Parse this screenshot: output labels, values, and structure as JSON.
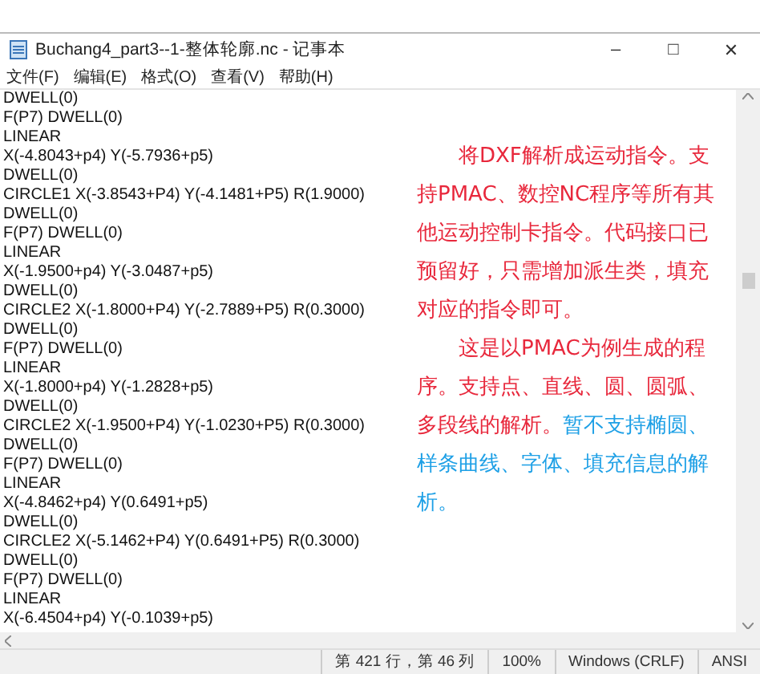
{
  "window": {
    "title": "Buchang4_part3--1-整体轮廓.nc - 记事本",
    "controls": [
      "–",
      "□",
      "✕"
    ]
  },
  "menu": [
    "文件(F)",
    "编辑(E)",
    "格式(O)",
    "查看(V)",
    "帮助(H)"
  ],
  "lines": [
    "DWELL(0)",
    "F(P7) DWELL(0)",
    "LINEAR",
    "X(-4.8043+p4) Y(-5.7936+p5)",
    "DWELL(0)",
    "CIRCLE1 X(-3.8543+P4) Y(-4.1481+P5) R(1.9000)",
    "DWELL(0)",
    "F(P7) DWELL(0)",
    "LINEAR",
    "X(-1.9500+p4) Y(-3.0487+p5)",
    "DWELL(0)",
    "CIRCLE2 X(-1.8000+P4) Y(-2.7889+P5) R(0.3000)",
    "DWELL(0)",
    "F(P7) DWELL(0)",
    "LINEAR",
    "X(-1.8000+p4) Y(-1.2828+p5)",
    "DWELL(0)",
    "CIRCLE2 X(-1.9500+P4) Y(-1.0230+P5) R(0.3000)",
    "DWELL(0)",
    "F(P7) DWELL(0)",
    "LINEAR",
    "X(-4.8462+p4) Y(0.6491+p5)",
    "DWELL(0)",
    "CIRCLE2 X(-5.1462+P4) Y(0.6491+P5) R(0.3000)",
    "DWELL(0)",
    "F(P7) DWELL(0)",
    "LINEAR",
    "X(-6.4504+p4) Y(-0.1039+p5)"
  ],
  "annotation": [
    {
      "segments": [
        {
          "text": "将DXF解析成运动指令。支持PMAC、数控NC程序等所有其他运动控制卡指令。代码接口已预留好，只需增加派生类，填充对应的指令即可。",
          "color": "#e8283c"
        }
      ]
    },
    {
      "segments": [
        {
          "text": "这是以PMAC为例生成的程序。支持点、直线、圆、圆弧、多段线的解析。",
          "color": "#e8283c"
        },
        {
          "text": "暂不支持椭圆、样条曲线、字体、填充信息的解析。",
          "color": "#1ea0e6"
        }
      ]
    }
  ],
  "status_bar": [
    "第 421 行，第 46 列",
    "100%",
    "Windows (CRLF)",
    "ANSI"
  ]
}
